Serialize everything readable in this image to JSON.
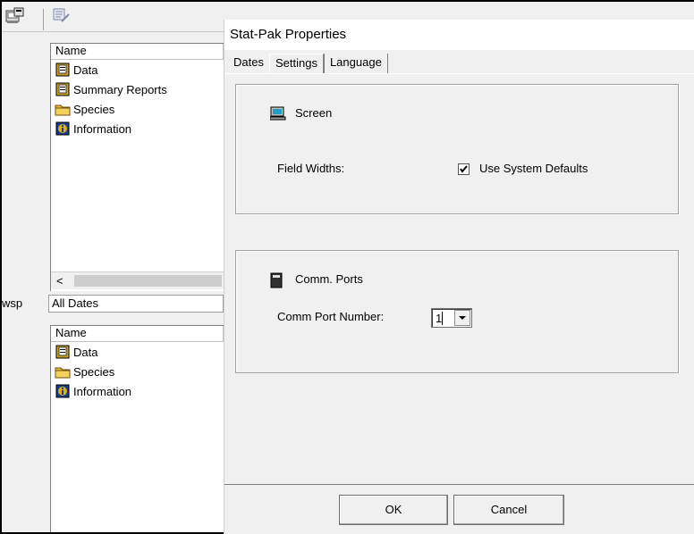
{
  "top_pane": {
    "column_name": "Name",
    "items": [
      {
        "label": "Data",
        "icon": "data-book-icon"
      },
      {
        "label": "Summary Reports",
        "icon": "reports-book-icon"
      },
      {
        "label": "Species",
        "icon": "folder-icon"
      },
      {
        "label": "Information",
        "icon": "info-book-icon"
      }
    ],
    "scroll_left_glyph": "<"
  },
  "left_label": "wsp",
  "dates_field": "All Dates",
  "bottom_pane": {
    "column_name": "Name",
    "items": [
      {
        "label": "Data",
        "icon": "data-book-icon"
      },
      {
        "label": "Species",
        "icon": "folder-icon"
      },
      {
        "label": "Information",
        "icon": "info-book-icon"
      }
    ]
  },
  "dialog": {
    "title": "Stat-Pak Properties",
    "tabs": [
      {
        "label": "Dates",
        "active": false
      },
      {
        "label": "Settings",
        "active": true
      },
      {
        "label": "Language",
        "active": false
      }
    ],
    "screen_group": {
      "label": "Screen",
      "field_widths_label": "Field Widths:",
      "checkbox_label": "Use System Defaults",
      "checkbox_checked": true
    },
    "comm_group": {
      "label": "Comm. Ports",
      "port_label": "Comm Port Number:",
      "port_value": "1"
    },
    "ok_label": "OK",
    "cancel_label": "Cancel"
  }
}
